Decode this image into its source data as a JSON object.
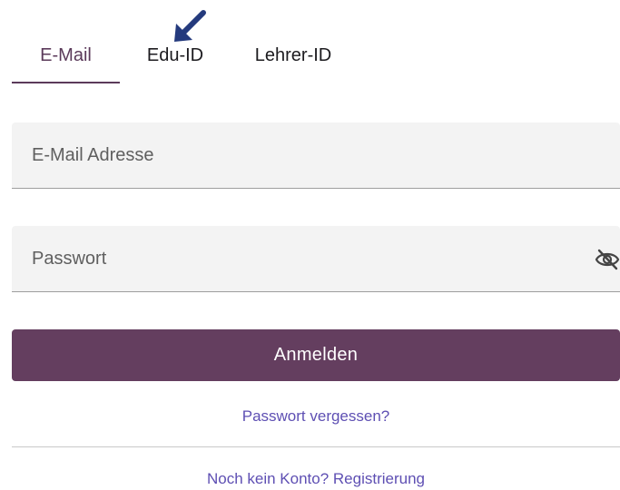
{
  "tabs": {
    "email": "E-Mail",
    "edu_id": "Edu-ID",
    "lehrer_id": "Lehrer-ID",
    "active": "E-Mail"
  },
  "form": {
    "email_placeholder": "E-Mail Adresse",
    "email_value": "",
    "password_placeholder": "Passwort",
    "password_value": "",
    "password_toggle_icon": "eye-off-icon"
  },
  "actions": {
    "login_label": "Anmelden",
    "forgot_password": "Passwort vergessen?",
    "register": "Noch kein Konto? Registrierung"
  },
  "annotation": {
    "arrow_icon": "arrow-down-left-icon",
    "arrow_color": "#243a7d"
  },
  "colors": {
    "primary": "#643e5f",
    "link": "#5e4fb3",
    "field_bg": "#f3f3f3"
  }
}
